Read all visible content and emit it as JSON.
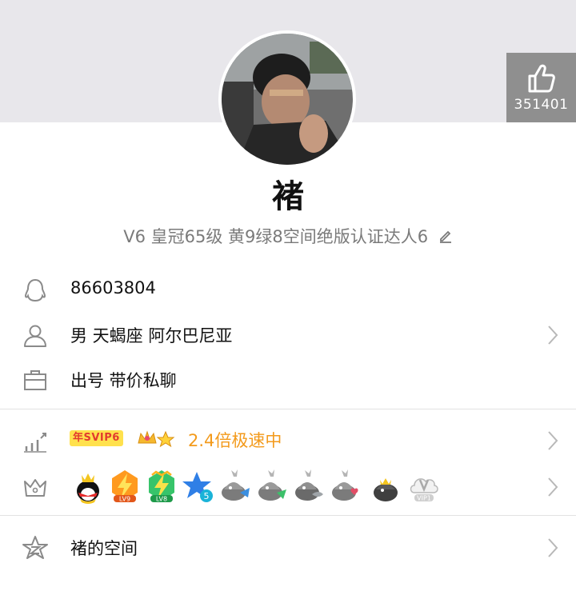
{
  "profile": {
    "like_count": "351401",
    "nickname": "褚",
    "subline": "V6 皇冠65级 黄9绿8空间绝版认证达人6",
    "qq_number": "86603804",
    "info": "男  天蝎座  阿尔巴尼亚",
    "sign": "出号   带价私聊",
    "svip_badge": "年SVIP6",
    "speed_text": "2.4倍极速中",
    "space_link": "褚的空间"
  },
  "badges": [
    {
      "icon": "qq-penguin-crown-icon"
    },
    {
      "icon": "lightning-lv9-icon",
      "label": "LV9"
    },
    {
      "icon": "lightning-lv8-icon",
      "label": "LV8"
    },
    {
      "icon": "star-5-icon",
      "label": "5"
    },
    {
      "icon": "penguin-helmet-blue-icon"
    },
    {
      "icon": "penguin-helmet-green-icon"
    },
    {
      "icon": "penguin-helmet-fish-icon"
    },
    {
      "icon": "penguin-helmet-heart-icon"
    },
    {
      "icon": "penguin-crown-dark-icon"
    },
    {
      "icon": "vip1-cloud-icon",
      "label": "VIP1"
    }
  ],
  "colors": {
    "accent_orange": "#f39a1b",
    "top_band": "#e8e7eb",
    "like_bg": "#8f8f8f"
  }
}
